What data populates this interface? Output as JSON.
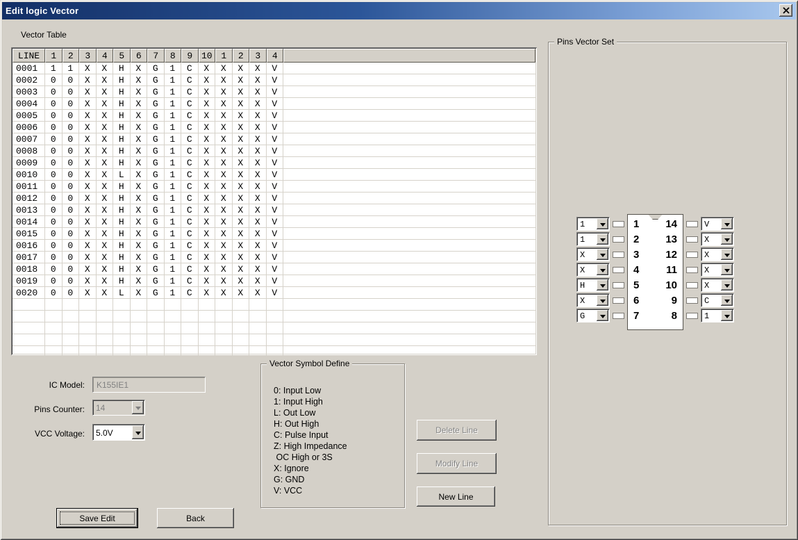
{
  "window": {
    "title": "Edit logic Vector"
  },
  "vector_table": {
    "section_label": "Vector Table",
    "headers": [
      "LINE",
      "1",
      "2",
      "3",
      "4",
      "5",
      "6",
      "7",
      "8",
      "9",
      "10",
      "1",
      "2",
      "3",
      "4"
    ],
    "rows": [
      {
        "line": "0001",
        "values": [
          "1",
          "1",
          "X",
          "X",
          "H",
          "X",
          "G",
          "1",
          "C",
          "X",
          "X",
          "X",
          "X",
          "V"
        ]
      },
      {
        "line": "0002",
        "values": [
          "0",
          "0",
          "X",
          "X",
          "H",
          "X",
          "G",
          "1",
          "C",
          "X",
          "X",
          "X",
          "X",
          "V"
        ]
      },
      {
        "line": "0003",
        "values": [
          "0",
          "0",
          "X",
          "X",
          "H",
          "X",
          "G",
          "1",
          "C",
          "X",
          "X",
          "X",
          "X",
          "V"
        ]
      },
      {
        "line": "0004",
        "values": [
          "0",
          "0",
          "X",
          "X",
          "H",
          "X",
          "G",
          "1",
          "C",
          "X",
          "X",
          "X",
          "X",
          "V"
        ]
      },
      {
        "line": "0005",
        "values": [
          "0",
          "0",
          "X",
          "X",
          "H",
          "X",
          "G",
          "1",
          "C",
          "X",
          "X",
          "X",
          "X",
          "V"
        ]
      },
      {
        "line": "0006",
        "values": [
          "0",
          "0",
          "X",
          "X",
          "H",
          "X",
          "G",
          "1",
          "C",
          "X",
          "X",
          "X",
          "X",
          "V"
        ]
      },
      {
        "line": "0007",
        "values": [
          "0",
          "0",
          "X",
          "X",
          "H",
          "X",
          "G",
          "1",
          "C",
          "X",
          "X",
          "X",
          "X",
          "V"
        ]
      },
      {
        "line": "0008",
        "values": [
          "0",
          "0",
          "X",
          "X",
          "H",
          "X",
          "G",
          "1",
          "C",
          "X",
          "X",
          "X",
          "X",
          "V"
        ]
      },
      {
        "line": "0009",
        "values": [
          "0",
          "0",
          "X",
          "X",
          "H",
          "X",
          "G",
          "1",
          "C",
          "X",
          "X",
          "X",
          "X",
          "V"
        ]
      },
      {
        "line": "0010",
        "values": [
          "0",
          "0",
          "X",
          "X",
          "L",
          "X",
          "G",
          "1",
          "C",
          "X",
          "X",
          "X",
          "X",
          "V"
        ]
      },
      {
        "line": "0011",
        "values": [
          "0",
          "0",
          "X",
          "X",
          "H",
          "X",
          "G",
          "1",
          "C",
          "X",
          "X",
          "X",
          "X",
          "V"
        ]
      },
      {
        "line": "0012",
        "values": [
          "0",
          "0",
          "X",
          "X",
          "H",
          "X",
          "G",
          "1",
          "C",
          "X",
          "X",
          "X",
          "X",
          "V"
        ]
      },
      {
        "line": "0013",
        "values": [
          "0",
          "0",
          "X",
          "X",
          "H",
          "X",
          "G",
          "1",
          "C",
          "X",
          "X",
          "X",
          "X",
          "V"
        ]
      },
      {
        "line": "0014",
        "values": [
          "0",
          "0",
          "X",
          "X",
          "H",
          "X",
          "G",
          "1",
          "C",
          "X",
          "X",
          "X",
          "X",
          "V"
        ]
      },
      {
        "line": "0015",
        "values": [
          "0",
          "0",
          "X",
          "X",
          "H",
          "X",
          "G",
          "1",
          "C",
          "X",
          "X",
          "X",
          "X",
          "V"
        ]
      },
      {
        "line": "0016",
        "values": [
          "0",
          "0",
          "X",
          "X",
          "H",
          "X",
          "G",
          "1",
          "C",
          "X",
          "X",
          "X",
          "X",
          "V"
        ]
      },
      {
        "line": "0017",
        "values": [
          "0",
          "0",
          "X",
          "X",
          "H",
          "X",
          "G",
          "1",
          "C",
          "X",
          "X",
          "X",
          "X",
          "V"
        ]
      },
      {
        "line": "0018",
        "values": [
          "0",
          "0",
          "X",
          "X",
          "H",
          "X",
          "G",
          "1",
          "C",
          "X",
          "X",
          "X",
          "X",
          "V"
        ]
      },
      {
        "line": "0019",
        "values": [
          "0",
          "0",
          "X",
          "X",
          "H",
          "X",
          "G",
          "1",
          "C",
          "X",
          "X",
          "X",
          "X",
          "V"
        ]
      },
      {
        "line": "0020",
        "values": [
          "0",
          "0",
          "X",
          "X",
          "L",
          "X",
          "G",
          "1",
          "C",
          "X",
          "X",
          "X",
          "X",
          "V"
        ]
      }
    ],
    "empty_rows": 5
  },
  "pins_vector_set": {
    "section_label": "Pins Vector Set",
    "left_pins": [
      {
        "pin": "1",
        "value": "1"
      },
      {
        "pin": "2",
        "value": "1"
      },
      {
        "pin": "3",
        "value": "X"
      },
      {
        "pin": "4",
        "value": "X"
      },
      {
        "pin": "5",
        "value": "H"
      },
      {
        "pin": "6",
        "value": "X"
      },
      {
        "pin": "7",
        "value": "G"
      }
    ],
    "right_pins": [
      {
        "pin": "14",
        "value": "V"
      },
      {
        "pin": "13",
        "value": "X"
      },
      {
        "pin": "12",
        "value": "X"
      },
      {
        "pin": "11",
        "value": "X"
      },
      {
        "pin": "10",
        "value": "X"
      },
      {
        "pin": "9",
        "value": "C"
      },
      {
        "pin": "8",
        "value": "1"
      }
    ]
  },
  "ic_form": {
    "ic_model_label": "IC Model:",
    "ic_model_value": "K155IE1",
    "pins_counter_label": "Pins Counter:",
    "pins_counter_value": "14",
    "vcc_voltage_label": "VCC Voltage:",
    "vcc_voltage_value": "5.0V"
  },
  "symbol_define": {
    "section_label": "Vector Symbol Define",
    "lines": [
      "0: Input Low",
      "1: Input High",
      "L: Out Low",
      "H: Out High",
      "C: Pulse Input",
      "Z: High Impedance",
      " OC High or 3S",
      "X: Ignore",
      "G: GND",
      "V: VCC"
    ]
  },
  "buttons": {
    "delete_line": "Delete Line",
    "modify_line": "Modify Line",
    "new_line": "New Line",
    "save_edit": "Save Edit",
    "back": "Back"
  },
  "colors": {
    "dialog_bg": "#d4d0c8",
    "titlebar_left": "#132f66",
    "titlebar_right": "#a9c8ee",
    "grid_line": "#d6d2ca",
    "disabled_text": "#808080"
  }
}
